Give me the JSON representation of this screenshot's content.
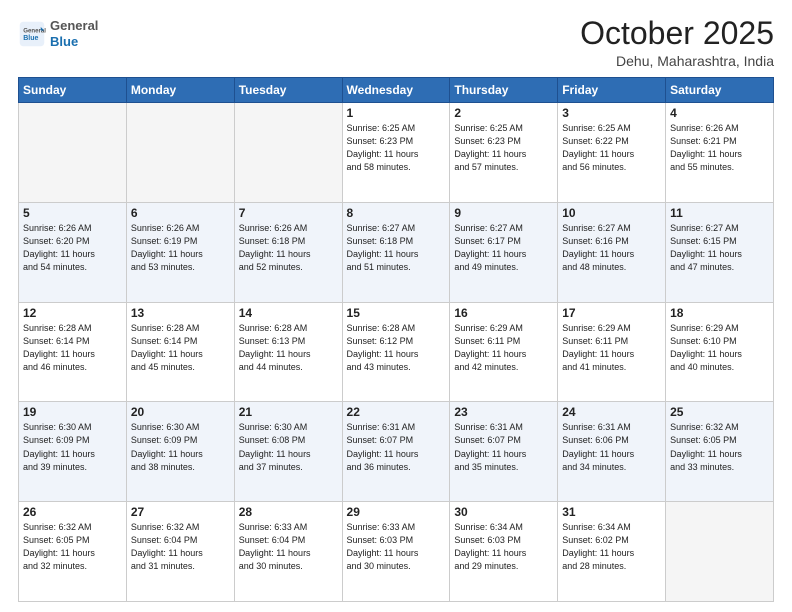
{
  "header": {
    "logo_general": "General",
    "logo_blue": "Blue",
    "month": "October 2025",
    "location": "Dehu, Maharashtra, India"
  },
  "weekdays": [
    "Sunday",
    "Monday",
    "Tuesday",
    "Wednesday",
    "Thursday",
    "Friday",
    "Saturday"
  ],
  "weeks": [
    [
      {
        "day": "",
        "info": ""
      },
      {
        "day": "",
        "info": ""
      },
      {
        "day": "",
        "info": ""
      },
      {
        "day": "1",
        "info": "Sunrise: 6:25 AM\nSunset: 6:23 PM\nDaylight: 11 hours\nand 58 minutes."
      },
      {
        "day": "2",
        "info": "Sunrise: 6:25 AM\nSunset: 6:23 PM\nDaylight: 11 hours\nand 57 minutes."
      },
      {
        "day": "3",
        "info": "Sunrise: 6:25 AM\nSunset: 6:22 PM\nDaylight: 11 hours\nand 56 minutes."
      },
      {
        "day": "4",
        "info": "Sunrise: 6:26 AM\nSunset: 6:21 PM\nDaylight: 11 hours\nand 55 minutes."
      }
    ],
    [
      {
        "day": "5",
        "info": "Sunrise: 6:26 AM\nSunset: 6:20 PM\nDaylight: 11 hours\nand 54 minutes."
      },
      {
        "day": "6",
        "info": "Sunrise: 6:26 AM\nSunset: 6:19 PM\nDaylight: 11 hours\nand 53 minutes."
      },
      {
        "day": "7",
        "info": "Sunrise: 6:26 AM\nSunset: 6:18 PM\nDaylight: 11 hours\nand 52 minutes."
      },
      {
        "day": "8",
        "info": "Sunrise: 6:27 AM\nSunset: 6:18 PM\nDaylight: 11 hours\nand 51 minutes."
      },
      {
        "day": "9",
        "info": "Sunrise: 6:27 AM\nSunset: 6:17 PM\nDaylight: 11 hours\nand 49 minutes."
      },
      {
        "day": "10",
        "info": "Sunrise: 6:27 AM\nSunset: 6:16 PM\nDaylight: 11 hours\nand 48 minutes."
      },
      {
        "day": "11",
        "info": "Sunrise: 6:27 AM\nSunset: 6:15 PM\nDaylight: 11 hours\nand 47 minutes."
      }
    ],
    [
      {
        "day": "12",
        "info": "Sunrise: 6:28 AM\nSunset: 6:14 PM\nDaylight: 11 hours\nand 46 minutes."
      },
      {
        "day": "13",
        "info": "Sunrise: 6:28 AM\nSunset: 6:14 PM\nDaylight: 11 hours\nand 45 minutes."
      },
      {
        "day": "14",
        "info": "Sunrise: 6:28 AM\nSunset: 6:13 PM\nDaylight: 11 hours\nand 44 minutes."
      },
      {
        "day": "15",
        "info": "Sunrise: 6:28 AM\nSunset: 6:12 PM\nDaylight: 11 hours\nand 43 minutes."
      },
      {
        "day": "16",
        "info": "Sunrise: 6:29 AM\nSunset: 6:11 PM\nDaylight: 11 hours\nand 42 minutes."
      },
      {
        "day": "17",
        "info": "Sunrise: 6:29 AM\nSunset: 6:11 PM\nDaylight: 11 hours\nand 41 minutes."
      },
      {
        "day": "18",
        "info": "Sunrise: 6:29 AM\nSunset: 6:10 PM\nDaylight: 11 hours\nand 40 minutes."
      }
    ],
    [
      {
        "day": "19",
        "info": "Sunrise: 6:30 AM\nSunset: 6:09 PM\nDaylight: 11 hours\nand 39 minutes."
      },
      {
        "day": "20",
        "info": "Sunrise: 6:30 AM\nSunset: 6:09 PM\nDaylight: 11 hours\nand 38 minutes."
      },
      {
        "day": "21",
        "info": "Sunrise: 6:30 AM\nSunset: 6:08 PM\nDaylight: 11 hours\nand 37 minutes."
      },
      {
        "day": "22",
        "info": "Sunrise: 6:31 AM\nSunset: 6:07 PM\nDaylight: 11 hours\nand 36 minutes."
      },
      {
        "day": "23",
        "info": "Sunrise: 6:31 AM\nSunset: 6:07 PM\nDaylight: 11 hours\nand 35 minutes."
      },
      {
        "day": "24",
        "info": "Sunrise: 6:31 AM\nSunset: 6:06 PM\nDaylight: 11 hours\nand 34 minutes."
      },
      {
        "day": "25",
        "info": "Sunrise: 6:32 AM\nSunset: 6:05 PM\nDaylight: 11 hours\nand 33 minutes."
      }
    ],
    [
      {
        "day": "26",
        "info": "Sunrise: 6:32 AM\nSunset: 6:05 PM\nDaylight: 11 hours\nand 32 minutes."
      },
      {
        "day": "27",
        "info": "Sunrise: 6:32 AM\nSunset: 6:04 PM\nDaylight: 11 hours\nand 31 minutes."
      },
      {
        "day": "28",
        "info": "Sunrise: 6:33 AM\nSunset: 6:04 PM\nDaylight: 11 hours\nand 30 minutes."
      },
      {
        "day": "29",
        "info": "Sunrise: 6:33 AM\nSunset: 6:03 PM\nDaylight: 11 hours\nand 30 minutes."
      },
      {
        "day": "30",
        "info": "Sunrise: 6:34 AM\nSunset: 6:03 PM\nDaylight: 11 hours\nand 29 minutes."
      },
      {
        "day": "31",
        "info": "Sunrise: 6:34 AM\nSunset: 6:02 PM\nDaylight: 11 hours\nand 28 minutes."
      },
      {
        "day": "",
        "info": ""
      }
    ]
  ]
}
